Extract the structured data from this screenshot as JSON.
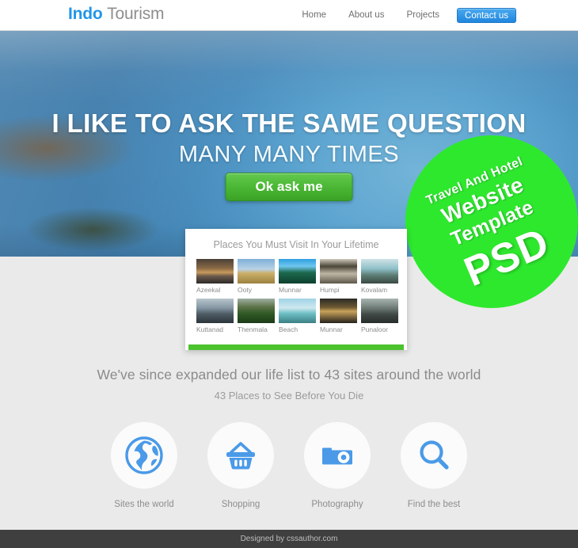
{
  "header": {
    "logo_brand": "Indo",
    "logo_suffix": "Tourism",
    "nav": [
      {
        "label": "Home",
        "cta": false
      },
      {
        "label": "About us",
        "cta": false
      },
      {
        "label": "Projects",
        "cta": false
      },
      {
        "label": "Contact us",
        "cta": true
      }
    ]
  },
  "hero": {
    "title": "I LIKE TO ASK THE SAME QUESTION",
    "subtitle": "MANY MANY TIMES",
    "button_label": "Ok ask me"
  },
  "badge": {
    "line1": "Travel And Hotel",
    "line2": "Website",
    "line3": "Template",
    "line4": "PSD",
    "color": "#2ee82e"
  },
  "card": {
    "title": "Places You Must Visit In Your Lifetime",
    "bar_color": "#4cc32e",
    "rows": [
      [
        {
          "label": "Azeekal",
          "art": "t-azeekal"
        },
        {
          "label": "Ooty",
          "art": "t-ooty"
        },
        {
          "label": "Munnar",
          "art": "t-munnar"
        },
        {
          "label": "Humpi",
          "art": "t-humpi"
        },
        {
          "label": "Kovalam",
          "art": "t-kovalam"
        }
      ],
      [
        {
          "label": "Kuttanad",
          "art": "t-kuttanad"
        },
        {
          "label": "Thenmala",
          "art": "t-thenmala"
        },
        {
          "label": "Beach",
          "art": "t-beach"
        },
        {
          "label": "Munnar",
          "art": "t-munnar2"
        },
        {
          "label": "Punaloor",
          "art": "t-punaloor"
        }
      ]
    ]
  },
  "mid": {
    "line1": "We've since expanded our life list to 43 sites around the world",
    "line2": "43 Places to See Before You Die"
  },
  "features": [
    {
      "label": "Sites the world",
      "icon": "globe-icon"
    },
    {
      "label": "Shopping",
      "icon": "basket-icon"
    },
    {
      "label": "Photography",
      "icon": "camera-icon"
    },
    {
      "label": "Find the best",
      "icon": "search-icon"
    }
  ],
  "footer": {
    "text": "Designed by cssauthor.com"
  },
  "colors": {
    "accent_blue": "#4a9ae8",
    "accent_green": "#4cb836",
    "page_bg": "#eaeaea",
    "footer_bg": "#3f3f3f"
  }
}
